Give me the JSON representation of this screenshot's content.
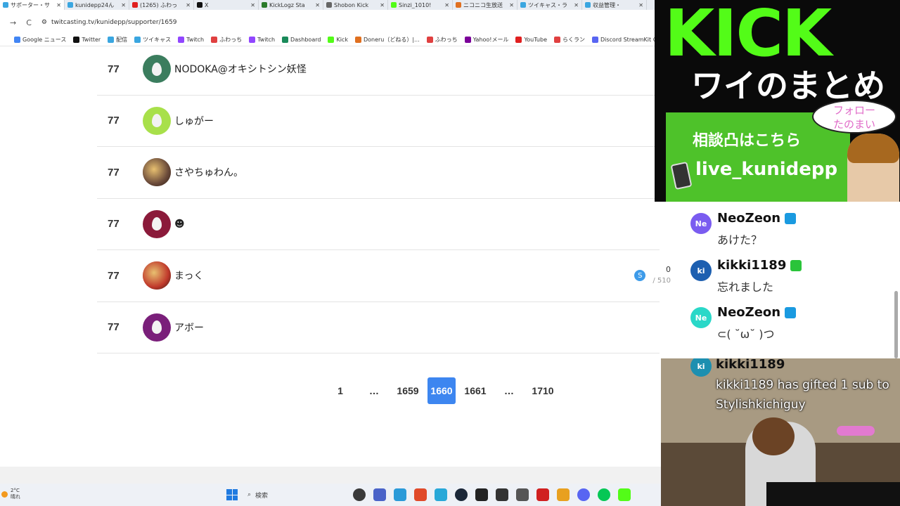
{
  "browser": {
    "tabs": [
      {
        "label": "サポーター・サ",
        "color": "#3aa6e0",
        "active": true
      },
      {
        "label": "kunidepp24ん",
        "color": "#3aa6e0"
      },
      {
        "label": "(1265) ふわっ",
        "color": "#e02020"
      },
      {
        "label": "X",
        "color": "#111111"
      },
      {
        "label": "KickLogz Sta",
        "color": "#2a7a2a"
      },
      {
        "label": "Shobon Kick",
        "color": "#666666"
      },
      {
        "label": "Sinzi_1010!",
        "color": "#53fc18"
      },
      {
        "label": "ニコニコ生放送",
        "color": "#e07020"
      },
      {
        "label": "ツイキャス・ラ",
        "color": "#3aa6e0"
      },
      {
        "label": "収益管理・",
        "color": "#3aa6e0"
      }
    ],
    "back_label": "→",
    "reload_label": "C",
    "url": "twitcasting.tv/kunidepp/supporter/1659",
    "bookmarks": [
      {
        "label": "Google ニュース",
        "color": "#4285f4"
      },
      {
        "label": "Twitter",
        "color": "#111111"
      },
      {
        "label": "配信",
        "color": "#3aa6e0"
      },
      {
        "label": "ツイキャス",
        "color": "#3aa6e0"
      },
      {
        "label": "Twitch",
        "color": "#9146ff"
      },
      {
        "label": "ふわっち",
        "color": "#e04040"
      },
      {
        "label": "Twitch",
        "color": "#9146ff"
      },
      {
        "label": "Dashboard",
        "color": "#1a8a5a"
      },
      {
        "label": "Kick",
        "color": "#53fc18"
      },
      {
        "label": "Doneru（どねる）|...",
        "color": "#e07020"
      },
      {
        "label": "ふわっち",
        "color": "#e04040"
      },
      {
        "label": "Yahoo!メール",
        "color": "#7b0099"
      },
      {
        "label": "YouTube",
        "color": "#e02020"
      },
      {
        "label": "らくラン",
        "color": "#e04040"
      },
      {
        "label": "Discord StreamKit O...",
        "color": "#5865f2"
      }
    ]
  },
  "supporters": [
    {
      "rank": "77",
      "name": "NODOKA@オキシトシン妖怪",
      "avatar_color": "#3b7d5e",
      "avatar_type": "egg"
    },
    {
      "rank": "77",
      "name": "しゅがー",
      "avatar_color": "#a8e04a",
      "avatar_type": "egg"
    },
    {
      "rank": "77",
      "name": "さやちゅわん。",
      "avatar_color": "#6a4a3a",
      "avatar_type": "photo"
    },
    {
      "rank": "77",
      "name": "☻",
      "avatar_color": "#8b1a3a",
      "avatar_type": "egg"
    },
    {
      "rank": "77",
      "name": "まっく",
      "avatar_color": "#c0392b",
      "avatar_type": "photo"
    },
    {
      "rank": "77",
      "name": "アボー",
      "avatar_color": "#7a1f7a",
      "avatar_type": "egg"
    }
  ],
  "supporter_points": {
    "value": "0",
    "total": "/ 510"
  },
  "pagination": {
    "pages": [
      "1",
      "…",
      "1659",
      "1660",
      "1661",
      "…",
      "1710"
    ],
    "current": "1660"
  },
  "taskbar": {
    "weather_temp": "2°C",
    "weather_desc": "晴れ",
    "search_placeholder": "検索",
    "icon_colors": [
      "#3a3a3a",
      "#4a63c8",
      "#2a9ad8",
      "#e04a2a",
      "#28a8d8",
      "#1b2838",
      "#222222",
      "#333333",
      "#555555",
      "#d02020",
      "#e8a020",
      "#5865f2",
      "#06c755",
      "#53fc18"
    ]
  },
  "overlay": {
    "kick_title": "KICK",
    "matome": "ワイのまとめ",
    "bubble_line1": "フォロー",
    "bubble_line2": "たのまい",
    "consult": "相談凸はこちら",
    "live_id": "live_kunidepp",
    "accent": "#53fc18"
  },
  "chat": [
    {
      "initials": "Ne",
      "name": "NeoZeon",
      "text": "あけた？",
      "avatar_color": "#7a5cf0",
      "badge_color": "#1a9ae0"
    },
    {
      "initials": "ki",
      "name": "kikki1189",
      "text": "忘れました",
      "avatar_color": "#1d5fb0",
      "badge_color": "#2ac43a"
    },
    {
      "initials": "Ne",
      "name": "NeoZeon",
      "text": "⊂( ˘ω˘ )つ",
      "avatar_color": "#2ad8c8",
      "badge_color": "#1a9ae0"
    }
  ],
  "cam_chat": {
    "initials": "ki",
    "name": "kikki1189",
    "text": "kikki1189 has gifted 1 sub to Stylishkichiguy"
  }
}
